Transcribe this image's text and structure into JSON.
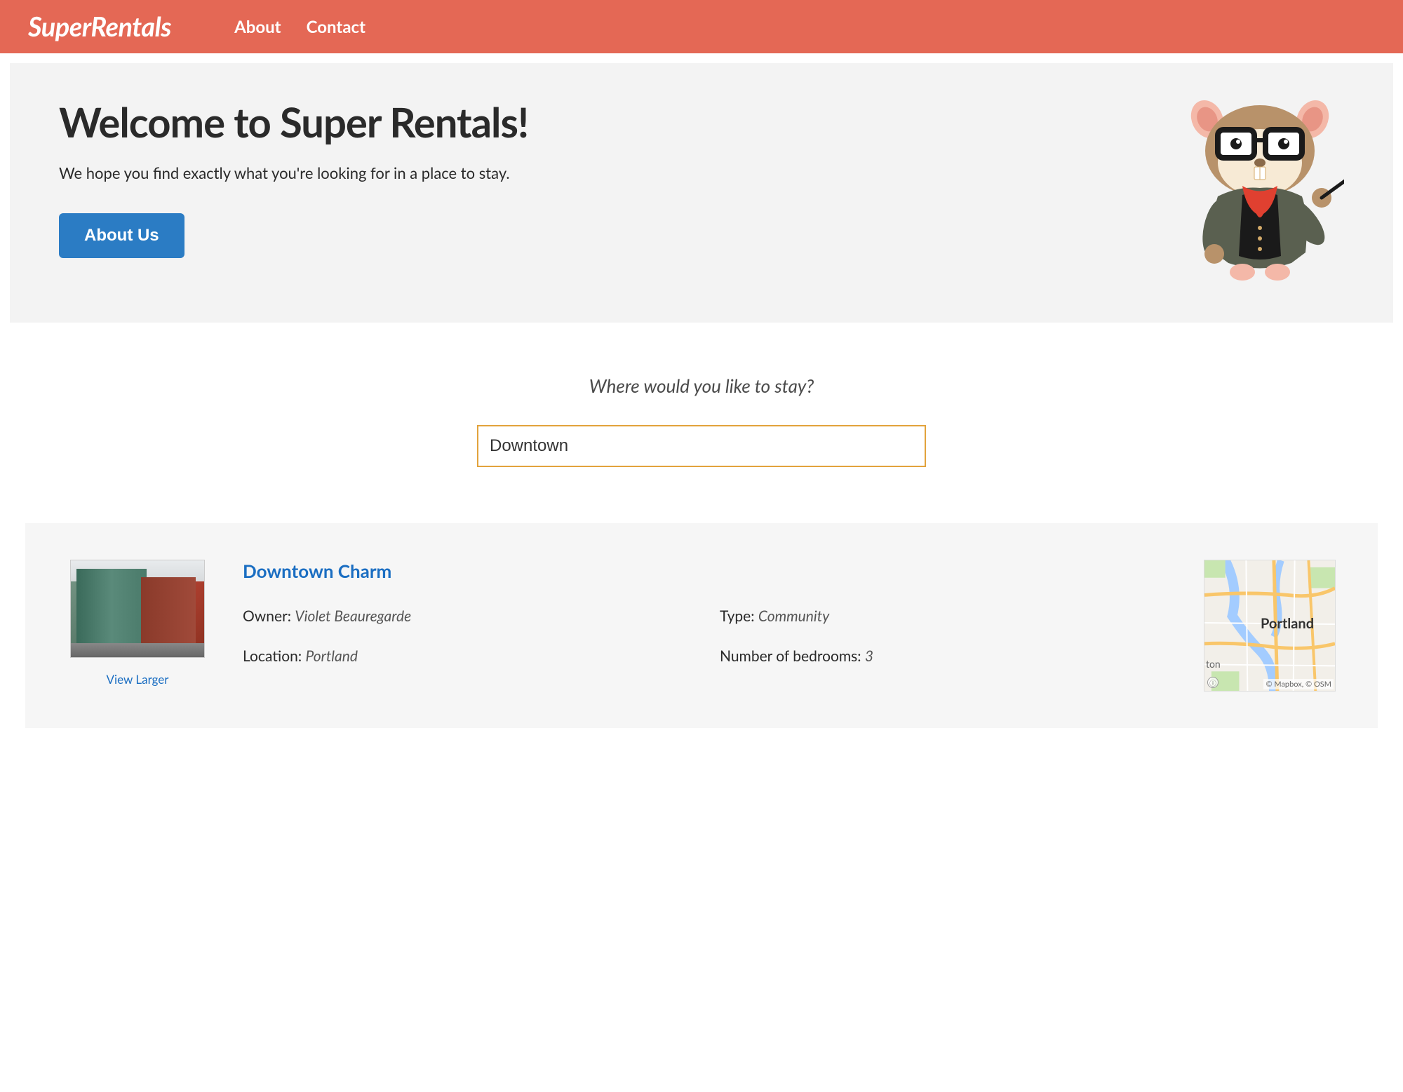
{
  "header": {
    "logo": "SuperRentals",
    "nav": [
      {
        "label": "About"
      },
      {
        "label": "Contact"
      }
    ]
  },
  "jumbo": {
    "title": "Welcome to Super Rentals!",
    "tagline": "We hope you find exactly what you're looking for in a place to stay.",
    "button_label": "About Us"
  },
  "search": {
    "label": "Where would you like to stay?",
    "value": "Downtown"
  },
  "listing": {
    "title": "Downtown Charm",
    "view_larger": "View Larger",
    "details": {
      "owner_label": "Owner:",
      "owner_value": "Violet Beauregarde",
      "type_label": "Type:",
      "type_value": "Community",
      "location_label": "Location:",
      "location_value": "Portland",
      "bedrooms_label": "Number of bedrooms:",
      "bedrooms_value": "3"
    },
    "map": {
      "city": "Portland",
      "alt_label": "ton",
      "attribution": "© Mapbox, © OSM"
    }
  }
}
